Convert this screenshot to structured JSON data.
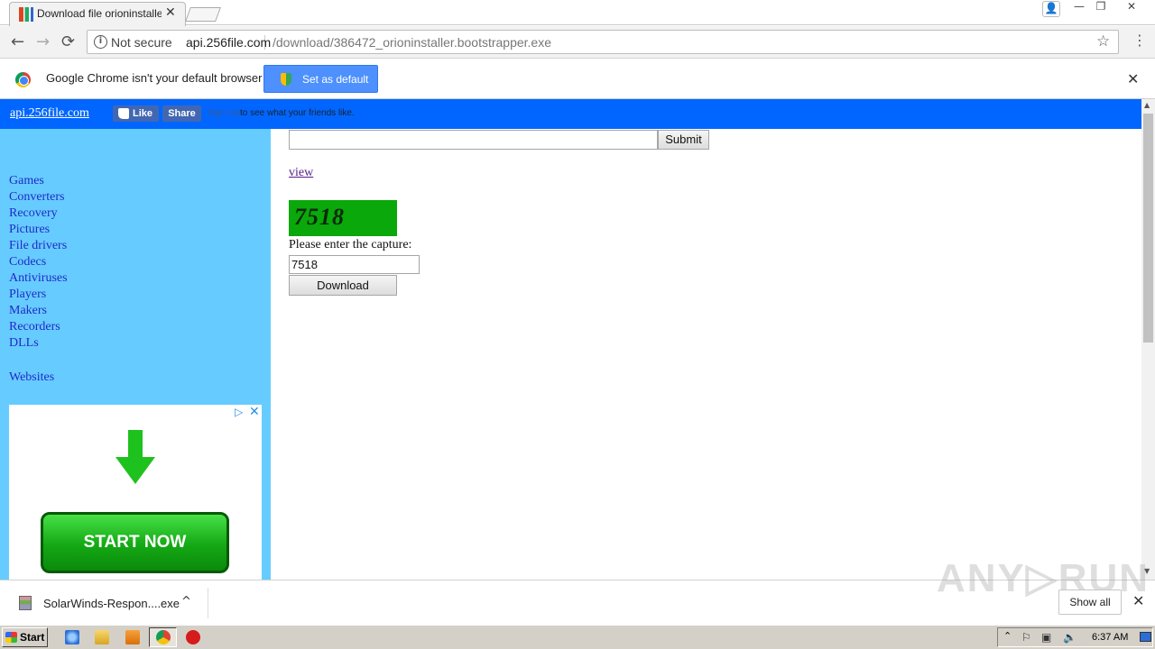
{
  "browser": {
    "tab_title": "Download file orioninstaller.b",
    "tab_close": "✕",
    "window_controls": {
      "user": "👤",
      "minimize": "—",
      "maximize": "❐",
      "close": "✕"
    },
    "nav": {
      "back": "←",
      "forward": "→",
      "reload": "⟳"
    },
    "omnibox": {
      "security_text": "Not secure",
      "url_host": "api.256file.com",
      "url_path": "/download/386472_orioninstaller.bootstrapper.exe",
      "star": "☆"
    },
    "menu": "⋮",
    "infobar": {
      "message": "Google Chrome isn't your default browser",
      "button_label": "Set as default",
      "close": "✕"
    }
  },
  "page": {
    "site_link": "api.256file.com",
    "fb": {
      "like": "Like",
      "share": "Share",
      "signup": "Sign Up",
      "text": "to see what your friends like."
    },
    "sidebar": {
      "items": [
        "Games",
        "Converters",
        "Recovery",
        "Pictures",
        "File drivers",
        "Codecs",
        "Antiviruses",
        "Players",
        "Makers",
        "Recorders",
        "DLLs"
      ],
      "websites": "Websites"
    },
    "ad": {
      "adchoices": "▷",
      "close": "✕",
      "button": "START NOW"
    },
    "search": {
      "value": "",
      "submit_label": "Submit"
    },
    "view_link": "view",
    "captcha_code": "7518",
    "capture_label": "Please enter the capture:",
    "capture_value": "7518",
    "download_label": "Download"
  },
  "scrollbar": {
    "up": "▲",
    "down": "▼"
  },
  "download_shelf": {
    "file_name": "SolarWinds-Respon....exe",
    "chevron": "^",
    "show_all": "Show all",
    "close": "✕",
    "watermark": "ANY▷RUN"
  },
  "taskbar": {
    "start": "Start",
    "tray_chevron": "⌃",
    "tray_icons": [
      "⚐",
      "▣",
      "🔈"
    ],
    "clock": "6:37 AM"
  },
  "colors": {
    "page_topbar": "#0066ff",
    "sidebar_bg": "#66ccff",
    "captcha_bg": "#0aa80a",
    "start_now": "#14a814",
    "chrome_button": "#4d90fe"
  }
}
